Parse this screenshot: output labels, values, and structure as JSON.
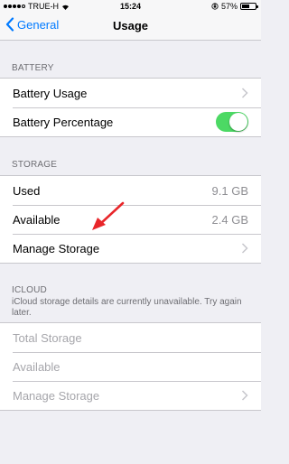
{
  "status_bar": {
    "carrier": "TRUE-H",
    "time": "15:24",
    "battery": "57%",
    "battery_level": 0.57
  },
  "nav": {
    "back_label": "General",
    "title": "Usage"
  },
  "battery_section": {
    "header": "BATTERY",
    "usage_label": "Battery Usage",
    "percentage_label": "Battery Percentage",
    "percentage_on": true
  },
  "storage_section": {
    "header": "STORAGE",
    "used_label": "Used",
    "used_value": "9.1 GB",
    "available_label": "Available",
    "available_value": "2.4 GB",
    "manage_label": "Manage Storage"
  },
  "icloud_section": {
    "header": "ICLOUD",
    "note": "iCloud storage details are currently unavailable. Try again later.",
    "total_label": "Total Storage",
    "available_label": "Available",
    "manage_label": "Manage Storage"
  },
  "colors": {
    "accent": "#007aff",
    "toggle_on": "#4cd964",
    "annotation_arrow": "#e8262a"
  }
}
